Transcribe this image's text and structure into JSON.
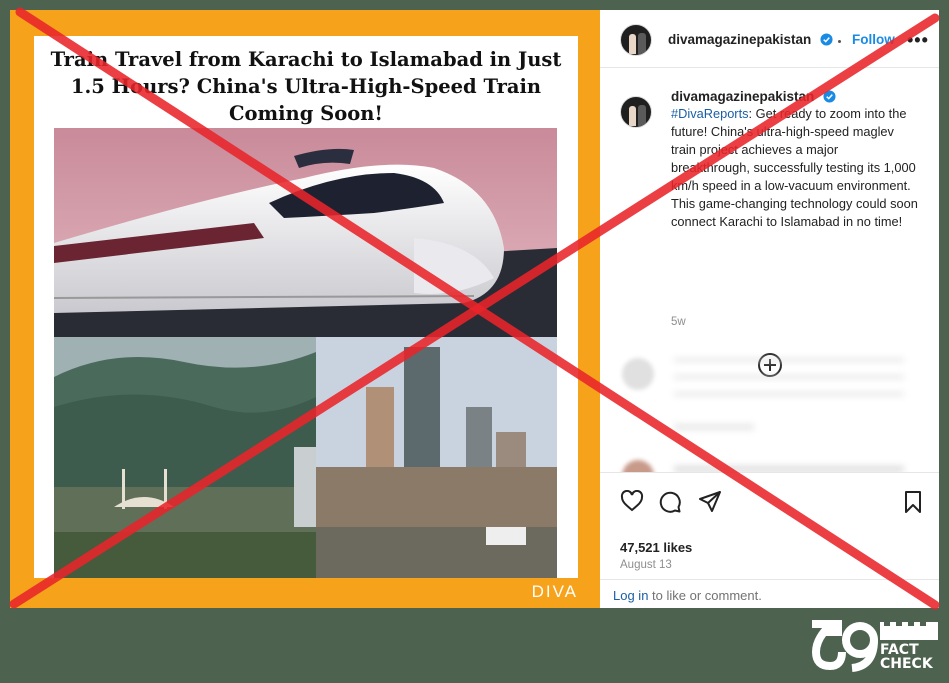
{
  "media": {
    "headline": "Train Travel from Karachi to Islamabad in Just 1.5 Hours? China's Ultra-High-Speed Train Coming Soon!",
    "watermark": "DIVA"
  },
  "post": {
    "username": "divamagazinepakistan",
    "follow_label": "Follow",
    "caption_hashtag": "#DivaReports",
    "caption_body": ": Get ready to zoom into the future! China's ultra-high-speed maglev train project achieves a major breakthrough, successfully testing its 1,000 km/h speed in a low-vacuum environment. This game-changing technology could soon connect Karachi to Islamabad in no time!",
    "age": "5w",
    "likes": "47,521 likes",
    "date": "August 13",
    "login_link": "Log in",
    "login_rest": " to like or comment."
  },
  "overlay": {
    "logo_line1": "FACT",
    "logo_line2": "CHECK",
    "cross_color": "#e8242a"
  },
  "icons": [
    "more-icon",
    "verified-icon",
    "heart-icon",
    "comment-icon",
    "share-icon",
    "bookmark-icon",
    "add-circle-icon"
  ],
  "colors": {
    "accent": "#1a8be4",
    "media_border": "#f7a21b",
    "background": "#4d6350"
  }
}
